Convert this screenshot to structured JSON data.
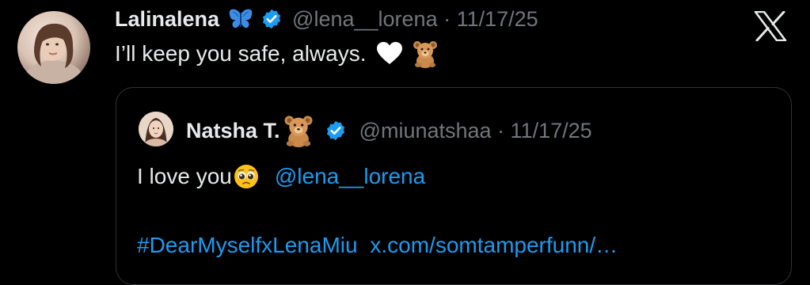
{
  "tweet": {
    "author_name": "Lalinalena",
    "author_handle": "@lena__lorena",
    "separator": "·",
    "date": "11/17/25",
    "handle_line": "@lena__lorena · 11/17/25",
    "text": "I’ll keep you safe, always.",
    "icons": [
      "avatar",
      "butterfly-emoji",
      "verified-badge-icon",
      "white-heart-emoji",
      "teddy-bear-emoji"
    ]
  },
  "quoted_tweet": {
    "author_name": "Natsha T.",
    "author_handle": "@miunatshaa",
    "date": "11/17/25",
    "handle_line": "@miunatshaa · 11/17/25",
    "text": "I love you",
    "mention": "@lena__lorena",
    "hashtag": "#DearMyselfxLenaMiu",
    "link": "x.com/somtamperfunn/…",
    "icons": [
      "avatar",
      "teddy-bear-emoji",
      "verified-badge-icon",
      "pleading-face-emoji"
    ]
  },
  "app": {
    "logo": "x-logo-icon"
  },
  "colors": {
    "background": "#000000",
    "primary_text": "#e7e9ea",
    "secondary_text": "#71767b",
    "link": "#1d9bf0",
    "border": "#2f3336",
    "verified": "#1d9bf0"
  }
}
